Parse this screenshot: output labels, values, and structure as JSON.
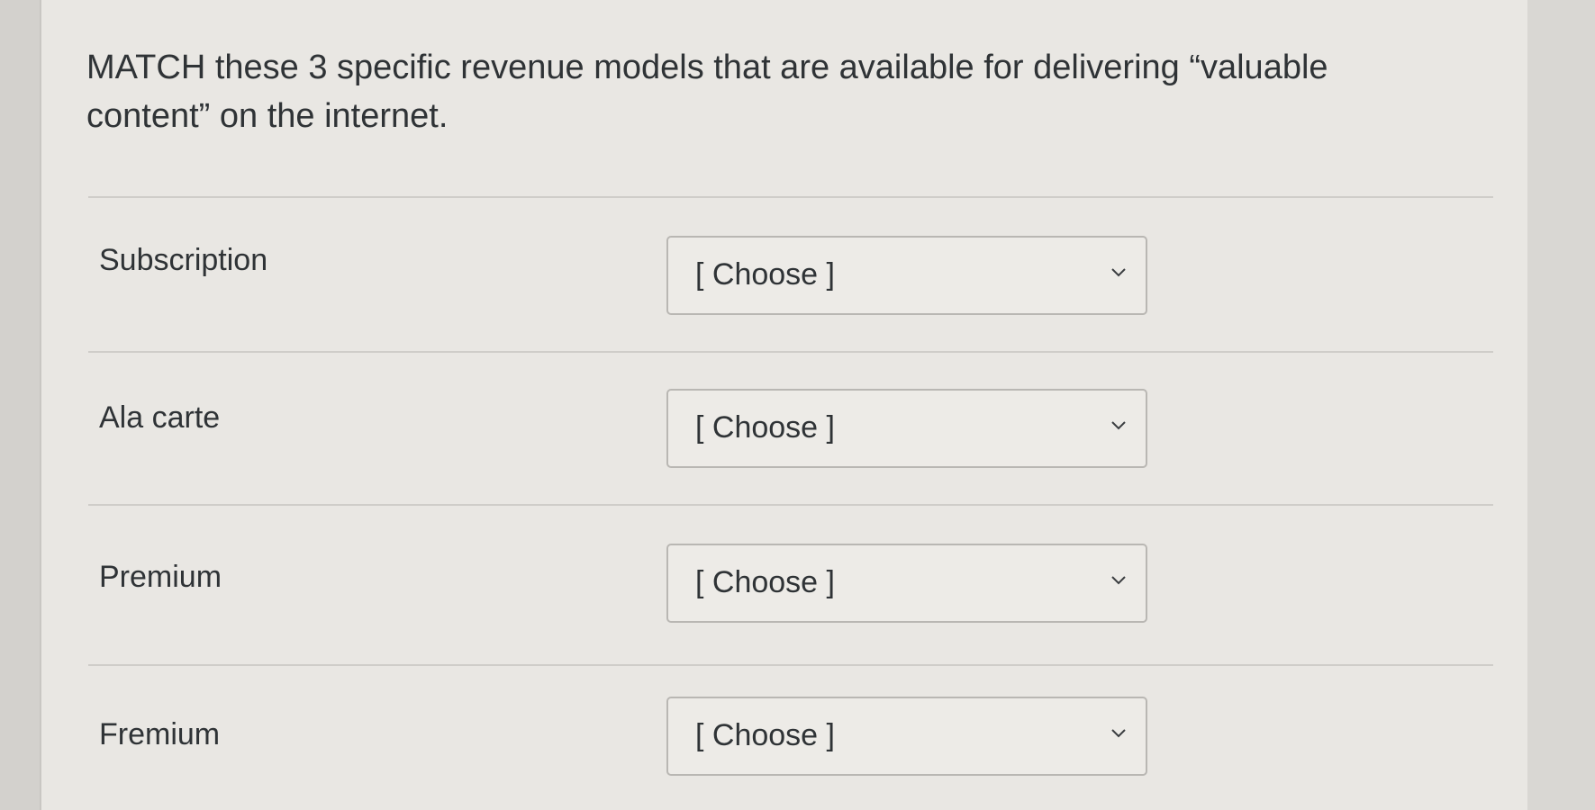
{
  "question": {
    "text": "MATCH these 3 specific revenue models that are available for delivering “valuable content” on the internet."
  },
  "rows": [
    {
      "label": "Subscription",
      "select_value": "[ Choose ]"
    },
    {
      "label": "Ala carte",
      "select_value": "[ Choose ]"
    },
    {
      "label": "Premium",
      "select_value": "[ Choose ]"
    },
    {
      "label": "Fremium",
      "select_value": "[ Choose ]"
    }
  ],
  "icons": {
    "dropdown": "chevron-down-icon"
  },
  "colors": {
    "text": "#2f3336",
    "card_background": "#e9e7e3",
    "select_border": "#b9b7b3"
  }
}
